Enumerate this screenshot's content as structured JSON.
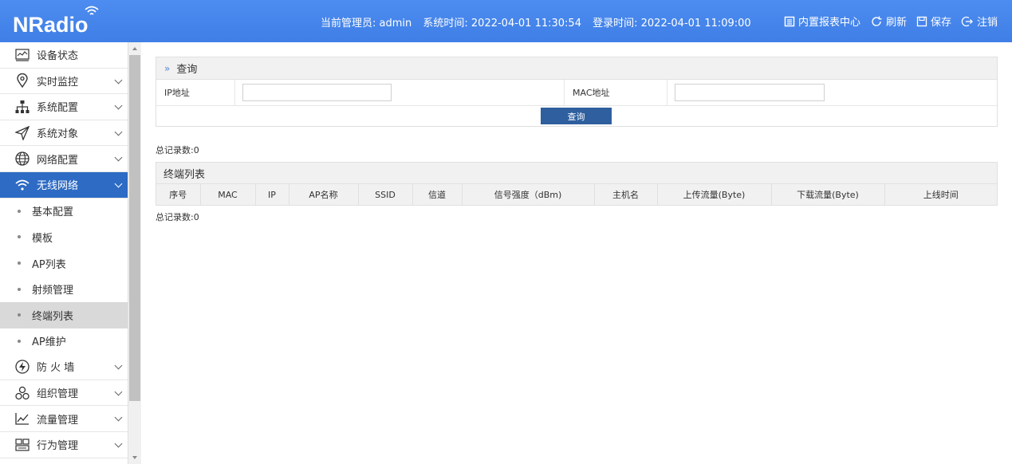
{
  "header": {
    "logo": "NRadio",
    "admin_label": "当前管理员: admin",
    "system_time": "系统时间: 2022-04-01 11:30:54",
    "login_time": "登录时间: 2022-04-01 11:09:00",
    "actions": [
      {
        "label": "内置报表中心",
        "icon": "report-icon"
      },
      {
        "label": "刷新",
        "icon": "refresh-icon"
      },
      {
        "label": "保存",
        "icon": "save-icon"
      },
      {
        "label": "注销",
        "icon": "logout-icon"
      }
    ]
  },
  "sidebar": {
    "items": [
      {
        "label": "设备状态",
        "icon": "monitor-icon"
      },
      {
        "label": "实时监控",
        "icon": "location-pin-icon"
      },
      {
        "label": "系统配置",
        "icon": "org-tree-icon"
      },
      {
        "label": "系统对象",
        "icon": "send-icon"
      },
      {
        "label": "网络配置",
        "icon": "globe-icon"
      },
      {
        "label": "无线网络",
        "icon": "wifi-icon"
      },
      {
        "label": "防 火 墙",
        "icon": "firewall-icon"
      },
      {
        "label": "组织管理",
        "icon": "people-icon"
      },
      {
        "label": "流量管理",
        "icon": "chart-line-icon"
      },
      {
        "label": "行为管理",
        "icon": "behavior-icon"
      }
    ],
    "subitems": [
      "基本配置",
      "模板",
      "AP列表",
      "射频管理",
      "终端列表",
      "AP维护"
    ]
  },
  "query": {
    "title": "查询",
    "ip_label": "IP地址",
    "mac_label": "MAC地址",
    "ip_value": "",
    "mac_value": "",
    "button": "查询"
  },
  "total_label": "总记录数:0",
  "list": {
    "title": "终端列表",
    "columns": [
      "序号",
      "MAC",
      "IP",
      "AP名称",
      "SSID",
      "信道",
      "信号强度（dBm)",
      "主机名",
      "上传流量(Byte)",
      "下载流量(Byte)",
      "上线时间"
    ]
  },
  "total_label_bottom": "总记录数:0",
  "colors": {
    "header": "#4a86e8",
    "active": "#2d6bc4",
    "button": "#2f5f9e"
  }
}
